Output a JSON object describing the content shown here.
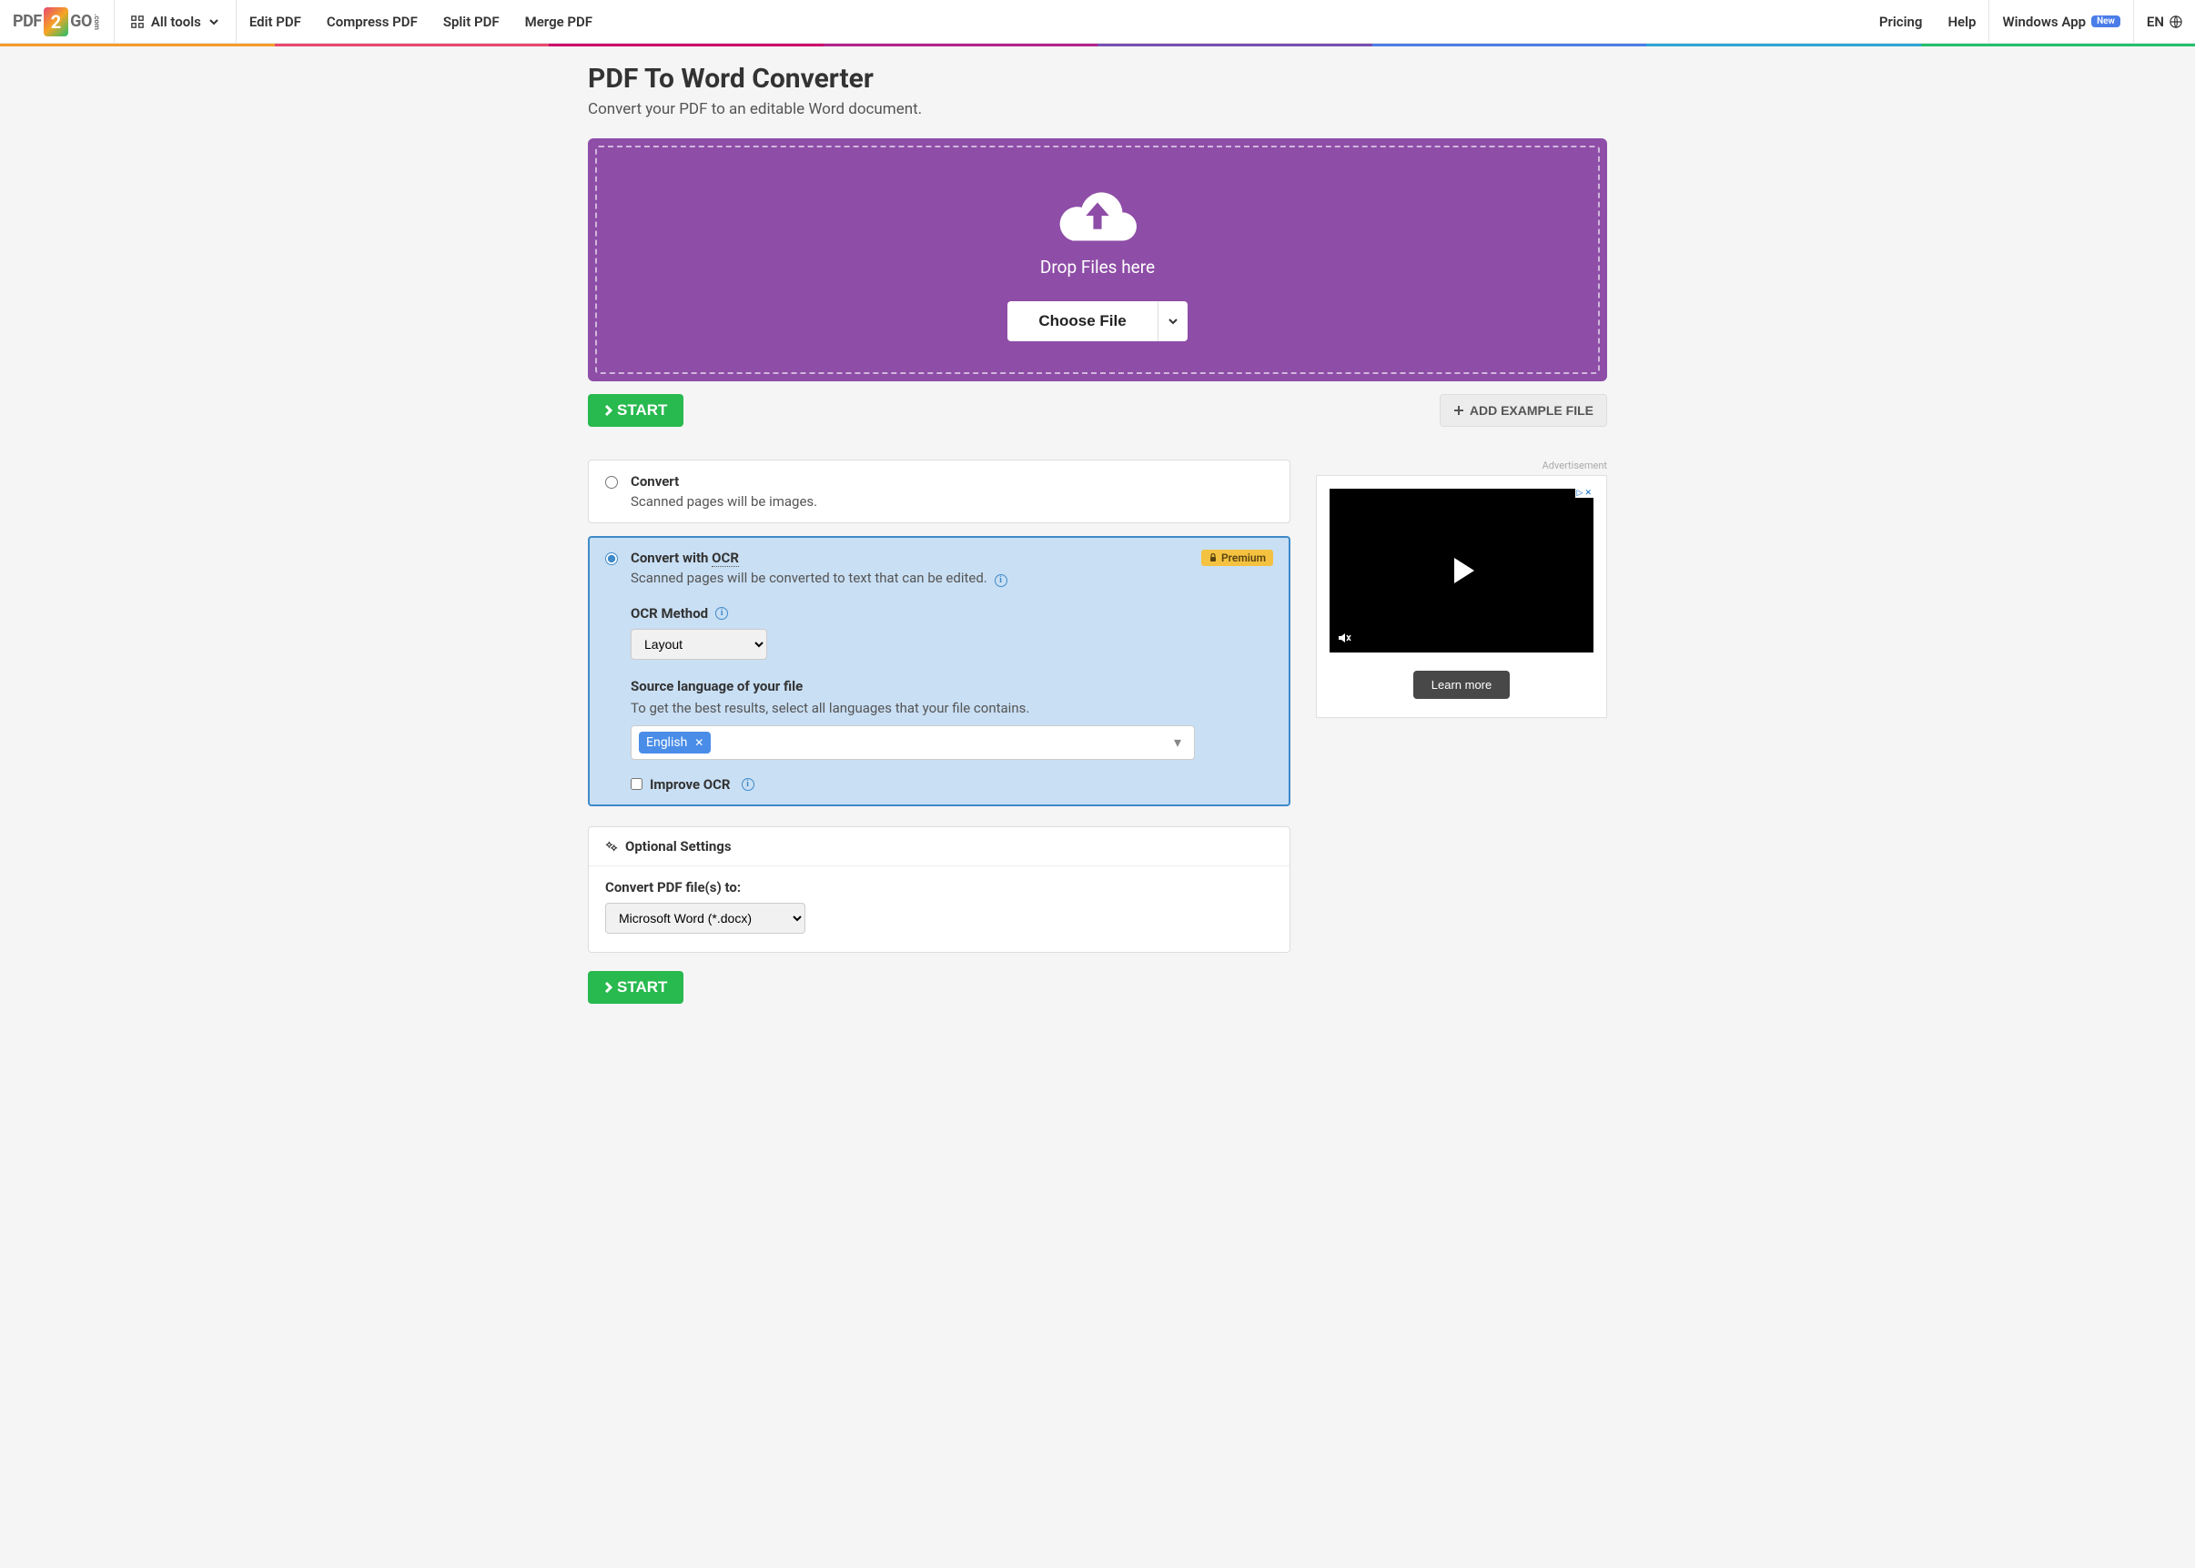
{
  "nav": {
    "all_tools": "All tools",
    "edit": "Edit PDF",
    "compress": "Compress PDF",
    "split": "Split PDF",
    "merge": "Merge PDF",
    "pricing": "Pricing",
    "help": "Help",
    "windows_app": "Windows App",
    "new_badge": "New",
    "lang": "EN"
  },
  "rainbow": [
    "#f59d2a",
    "#e94770",
    "#cf006b",
    "#b3258c",
    "#7a4fb3",
    "#4a7de8",
    "#2da6d8",
    "#23c06c"
  ],
  "page": {
    "title": "PDF To Word Converter",
    "subtitle": "Convert your PDF to an editable Word document."
  },
  "drop": {
    "text": "Drop Files here",
    "choose": "Choose File"
  },
  "actions": {
    "start": "START",
    "add_example": "ADD EXAMPLE FILE"
  },
  "options": {
    "convert": {
      "title": "Convert",
      "desc": "Scanned pages will be images."
    },
    "convert_ocr": {
      "title_prefix": "Convert with ",
      "ocr_abbr": "OCR",
      "desc": "Scanned pages will be converted to text that can be edited.",
      "premium": "Premium",
      "method_label": "OCR Method",
      "method_value": "Layout",
      "source_label": "Source language of your file",
      "source_help": "To get the best results, select all languages that your file contains.",
      "lang_chip": "English",
      "improve": "Improve OCR"
    }
  },
  "settings": {
    "header": "Optional Settings",
    "convert_to_label": "Convert PDF file(s) to:",
    "convert_to_value": "Microsoft Word (*.docx)"
  },
  "ad": {
    "label": "Advertisement",
    "learn": "Learn more"
  }
}
